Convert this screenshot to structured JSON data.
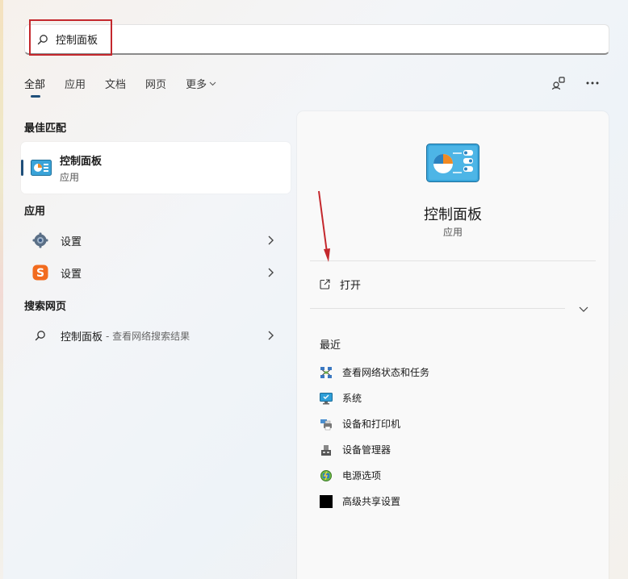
{
  "search": {
    "value": "控制面板"
  },
  "tabs": [
    {
      "label": "全部"
    },
    {
      "label": "应用"
    },
    {
      "label": "文档"
    },
    {
      "label": "网页"
    },
    {
      "label": "更多"
    }
  ],
  "sections": {
    "best_match": "最佳匹配",
    "apps": "应用",
    "web": "搜索网页"
  },
  "best_match": {
    "name": "控制面板",
    "type": "应用"
  },
  "apps": [
    {
      "label": "设置",
      "icon": "gear-icon"
    },
    {
      "label": "设置",
      "icon": "sogou-s-icon"
    }
  ],
  "web_result": {
    "label": "控制面板",
    "sub": "- 查看网络搜索结果"
  },
  "panel": {
    "title": "控制面板",
    "subtitle": "应用",
    "open_label": "打开",
    "recent_title": "最近",
    "recent_items": [
      {
        "label": "查看网络状态和任务",
        "icon": "network-icon"
      },
      {
        "label": "系统",
        "icon": "monitor-icon"
      },
      {
        "label": "设备和打印机",
        "icon": "printer-icon"
      },
      {
        "label": "设备管理器",
        "icon": "device-manager-icon"
      },
      {
        "label": "电源选项",
        "icon": "power-options-icon"
      },
      {
        "label": "高级共享设置",
        "icon": "black-square-icon"
      }
    ]
  },
  "colors": {
    "accent": "#1f4f7a",
    "highlight_red": "#c4282d",
    "panel_bg": "#f9f9f9"
  }
}
